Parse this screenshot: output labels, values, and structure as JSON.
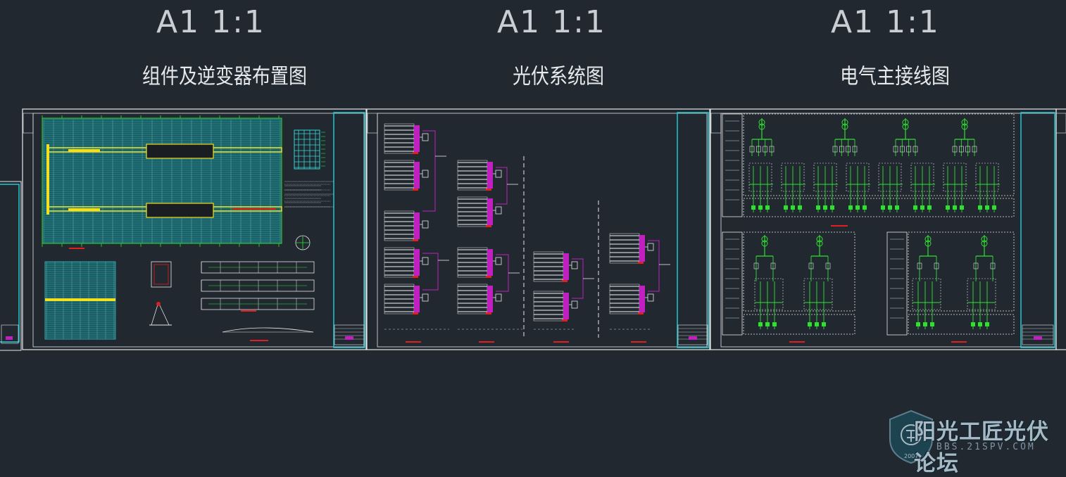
{
  "sheets": [
    {
      "scale": "A1 1:1",
      "title": "组件及逆变器布置图"
    },
    {
      "scale": "A1 1:1",
      "title": "光伏系统图"
    },
    {
      "scale": "A1 1:1",
      "title": "电气主接线图"
    }
  ],
  "watermark": {
    "text": "阳光工匠光伏论坛",
    "url": "BBS.21SPV.COM",
    "year": "2007"
  },
  "colors": {
    "background": "#212830",
    "frame": "#e8e8e8",
    "title_block": "#20c8d0",
    "pv_array": "#2fd8d8",
    "wire_yellow": "#f0e020",
    "combiner_magenta": "#c020c0",
    "grid_green": "#30e030",
    "accent_red": "#e02020"
  }
}
